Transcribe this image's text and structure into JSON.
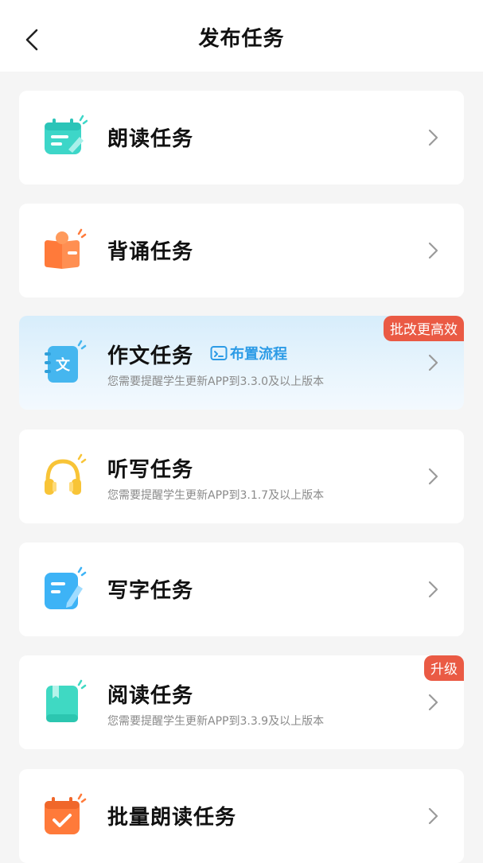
{
  "header": {
    "title": "发布任务"
  },
  "tasks": [
    {
      "title": "朗读任务"
    },
    {
      "title": "背诵任务"
    },
    {
      "title": "作文任务",
      "link": "布置流程",
      "subtitle": "您需要提醒学生更新APP到3.3.0及以上版本",
      "badge": "批改更高效"
    },
    {
      "title": "听写任务",
      "subtitle": "您需要提醒学生更新APP到3.1.7及以上版本"
    },
    {
      "title": "写字任务"
    },
    {
      "title": "阅读任务",
      "subtitle": "您需要提醒学生更新APP到3.3.9及以上版本",
      "badge": "升级"
    },
    {
      "title": "批量朗读任务"
    }
  ],
  "colors": {
    "accent_red": "#ea5a44",
    "link_blue": "#2c9be6",
    "reading_icon": "#3dd6c8",
    "recite_icon": "#ff7a3a",
    "essay_icon": "#45b6ef",
    "dictation_icon": "#f8c437",
    "writing_icon": "#3db3f6",
    "read_icon": "#3fd9c3",
    "batch_icon": "#ff7a3a"
  },
  "icons": [
    "back-arrow-icon",
    "reading-icon",
    "recite-icon",
    "essay-icon",
    "dictation-headphones-icon",
    "writing-icon",
    "reading-book-icon",
    "batch-reading-icon",
    "chevron-right-icon",
    "flow-icon"
  ]
}
